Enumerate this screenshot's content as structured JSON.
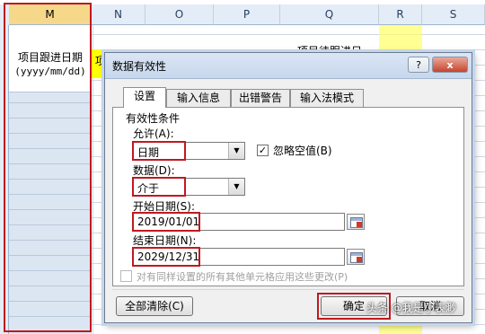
{
  "sheet": {
    "columns": [
      "M",
      "N",
      "O",
      "P",
      "Q",
      "R",
      "S"
    ],
    "m_header_line1": "项目跟进日期",
    "m_header_line2": "(yyyy/mm/dd)",
    "n_cell": "项",
    "q_cell": "项目待跟进日"
  },
  "dialog": {
    "title": "数据有效性",
    "help_button": "?",
    "close_button": "x",
    "tabs": [
      "设置",
      "输入信息",
      "出错警告",
      "输入法模式"
    ],
    "section_label": "有效性条件",
    "allow_label": "允许(A):",
    "allow_value": "日期",
    "ignore_blank_label": "忽略空值(B)",
    "ignore_blank_checked": "✓",
    "data_label": "数据(D):",
    "data_value": "介于",
    "start_label": "开始日期(S):",
    "start_value": "2019/01/01",
    "end_label": "结束日期(N):",
    "end_value": "2029/12/31",
    "apply_all_label": "对有同样设置的所有其他单元格应用这些更改(P)",
    "clear_all_button": "全部清除(C)",
    "ok_button": "确定",
    "cancel_button": "取消"
  },
  "watermark": "头条 @我是小表渺",
  "colors": {
    "highlight_red": "#c0191f",
    "selected_column": "#dce6f2",
    "yellow_fill": "#ffff00"
  }
}
